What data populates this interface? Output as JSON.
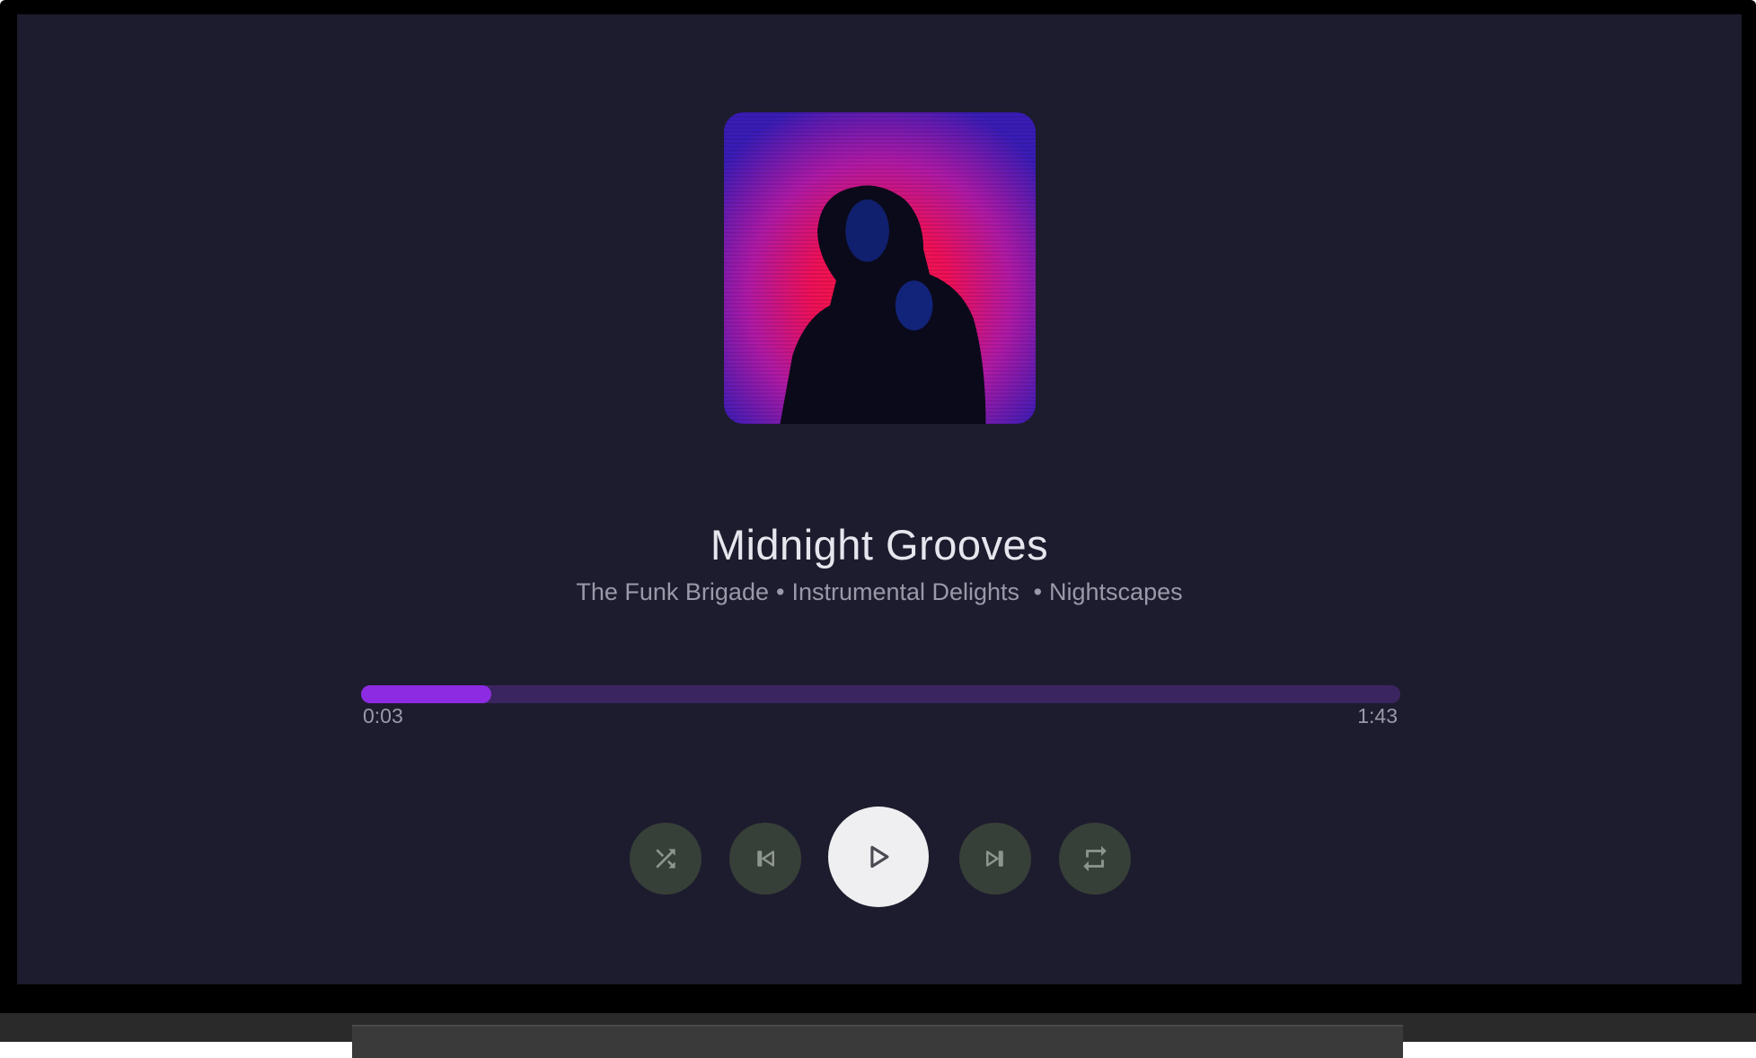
{
  "track": {
    "title": "Midnight Grooves",
    "artist": "The Funk Brigade",
    "separator": "•",
    "album": "Instrumental Delights",
    "playlist": "Nightscapes"
  },
  "playback": {
    "elapsed": "0:03",
    "total": "1:43",
    "progress_fraction": 0.125
  },
  "controls": {
    "shuffle_icon": "shuffle-icon",
    "previous_icon": "skip-previous-icon",
    "play_icon": "play-icon",
    "next_icon": "skip-next-icon",
    "repeat_icon": "repeat-icon"
  },
  "colors": {
    "background": "#1d1c2e",
    "accent": "#8d2be2",
    "track": "#3b2560",
    "button": "#374038"
  }
}
